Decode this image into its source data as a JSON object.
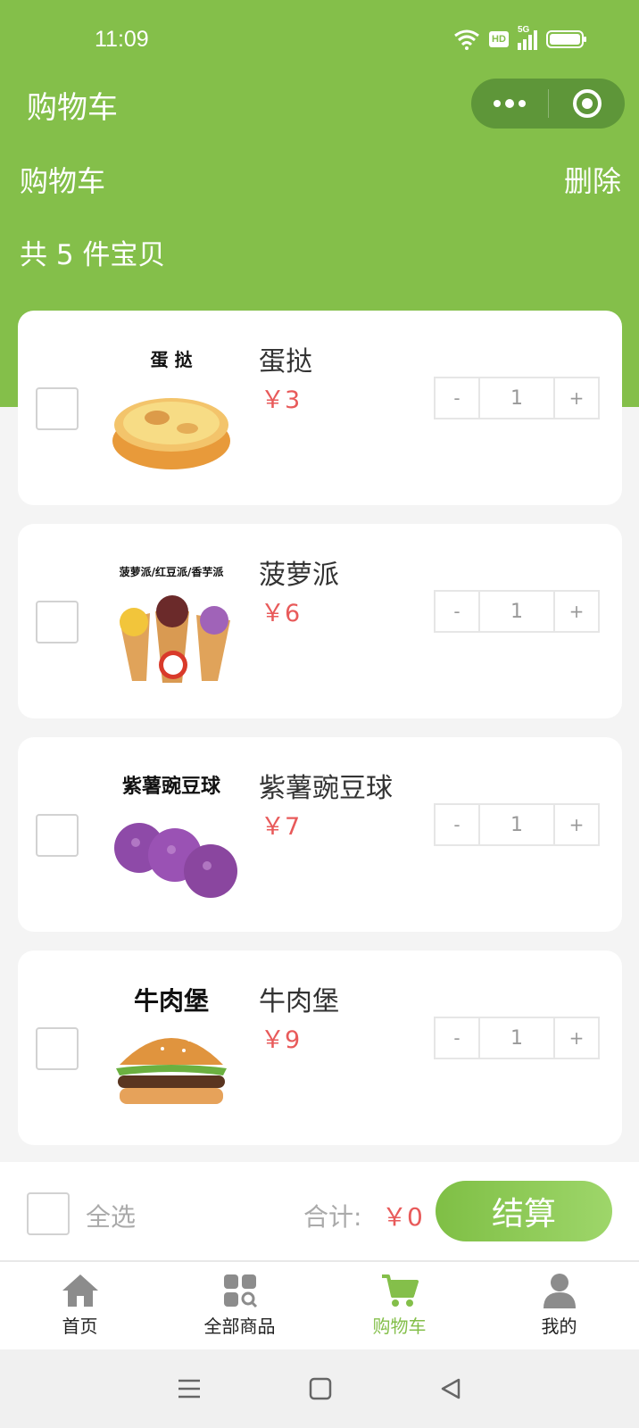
{
  "status_bar": {
    "time": "11:09",
    "network": "5G",
    "hd": "HD"
  },
  "nav": {
    "title": "购物车"
  },
  "header": {
    "subtitle": "购物车",
    "delete_label": "删除",
    "count_text": "共 5 件宝贝"
  },
  "items": [
    {
      "image_caption": "蛋 挞",
      "name": "蛋挞",
      "price": "￥3",
      "minus": "-",
      "qty": "1",
      "plus": "+"
    },
    {
      "image_caption": "菠萝派/红豆派/香芋派",
      "name": "菠萝派",
      "price": "￥6",
      "minus": "-",
      "qty": "1",
      "plus": "+"
    },
    {
      "image_caption": "紫薯豌豆球",
      "name": "紫薯豌豆球",
      "price": "￥7",
      "minus": "-",
      "qty": "1",
      "plus": "+"
    },
    {
      "image_caption": "牛肉堡",
      "name": "牛肉堡",
      "price": "￥9",
      "minus": "-",
      "qty": "1",
      "plus": "+"
    }
  ],
  "bottom_bar": {
    "select_all": "全选",
    "total_label": "合计:",
    "total_value": "￥0",
    "checkout": "结算"
  },
  "tabs": [
    {
      "label": "首页",
      "icon": "home-icon"
    },
    {
      "label": "全部商品",
      "icon": "category-search-icon"
    },
    {
      "label": "购物车",
      "icon": "cart-icon",
      "active": true
    },
    {
      "label": "我的",
      "icon": "user-icon"
    }
  ],
  "colors": {
    "accent": "#84bf4a",
    "price": "#e85a5a",
    "capsule": "#5e9639"
  }
}
